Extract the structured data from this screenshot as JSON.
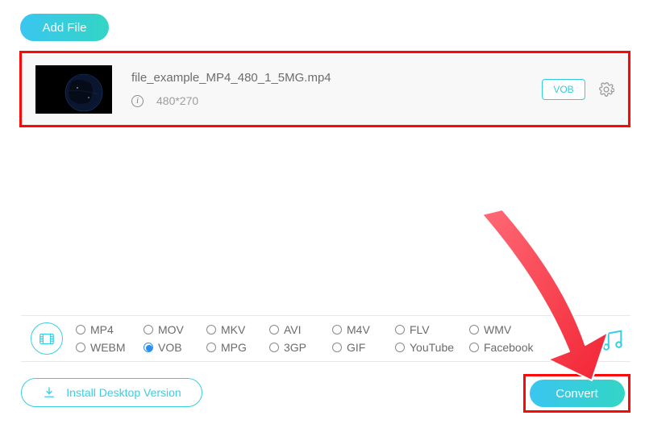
{
  "header": {
    "add_file_label": "Add File"
  },
  "file": {
    "name": "file_example_MP4_480_1_5MG.mp4",
    "resolution": "480*270",
    "format_badge": "VOB"
  },
  "formats": {
    "options": [
      {
        "label": "MP4",
        "selected": false
      },
      {
        "label": "MOV",
        "selected": false
      },
      {
        "label": "MKV",
        "selected": false
      },
      {
        "label": "AVI",
        "selected": false
      },
      {
        "label": "M4V",
        "selected": false
      },
      {
        "label": "FLV",
        "selected": false
      },
      {
        "label": "WMV",
        "selected": false
      },
      {
        "label": "WEBM",
        "selected": false
      },
      {
        "label": "VOB",
        "selected": true
      },
      {
        "label": "MPG",
        "selected": false
      },
      {
        "label": "3GP",
        "selected": false
      },
      {
        "label": "GIF",
        "selected": false
      },
      {
        "label": "YouTube",
        "selected": false
      },
      {
        "label": "Facebook",
        "selected": false
      }
    ]
  },
  "footer": {
    "install_label": "Install Desktop Version",
    "convert_label": "Convert"
  },
  "colors": {
    "accent": "#37cfe3",
    "annotate_red": "#fc0808"
  }
}
